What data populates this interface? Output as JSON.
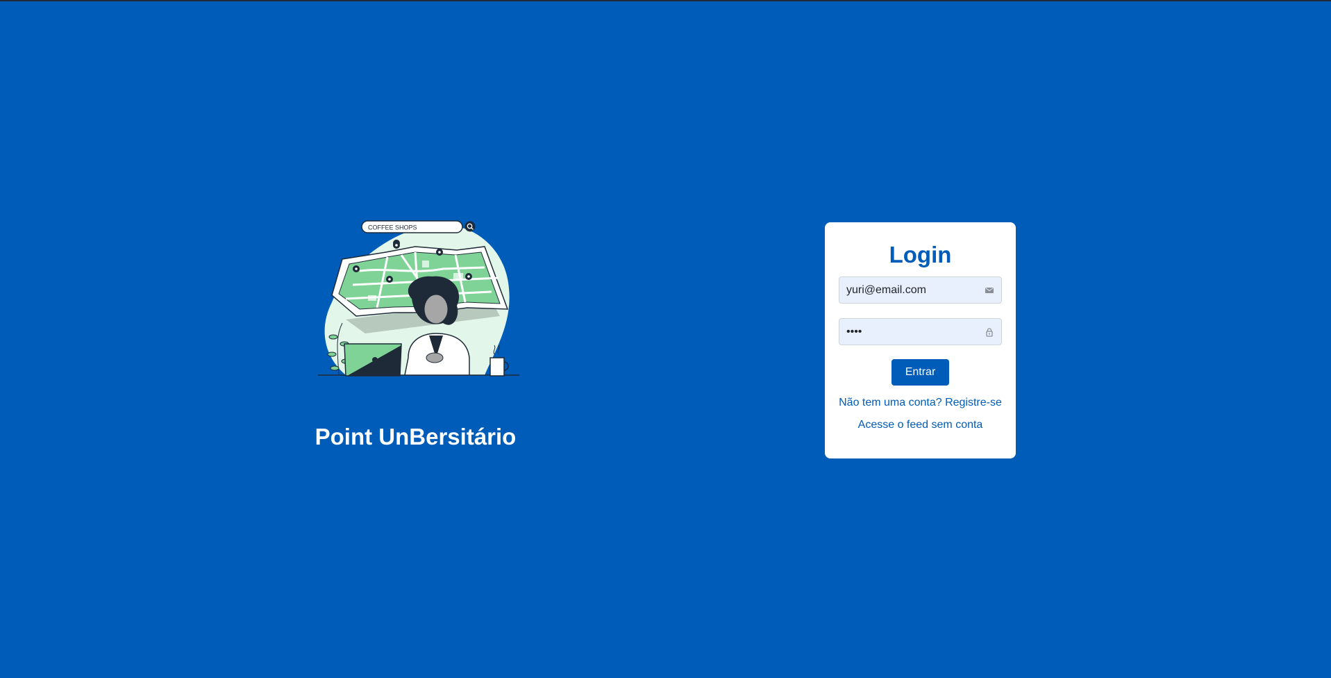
{
  "brand": {
    "title": "Point UnBersitário",
    "illustration": {
      "search_text": "COFFEE SHOPS",
      "icon": "search-icon"
    }
  },
  "login": {
    "title": "Login",
    "email": {
      "value": "yuri@email.com",
      "icon": "envelope-icon"
    },
    "password": {
      "value": "1234",
      "icon": "lock-icon"
    },
    "submit_label": "Entrar",
    "register_link": "Não tem uma conta? Registre-se",
    "feed_link": "Acesse o feed sem conta"
  },
  "colors": {
    "background": "#005cb9",
    "accent": "#005cb9",
    "card": "#ffffff",
    "input_bg": "#e8f0fe"
  }
}
